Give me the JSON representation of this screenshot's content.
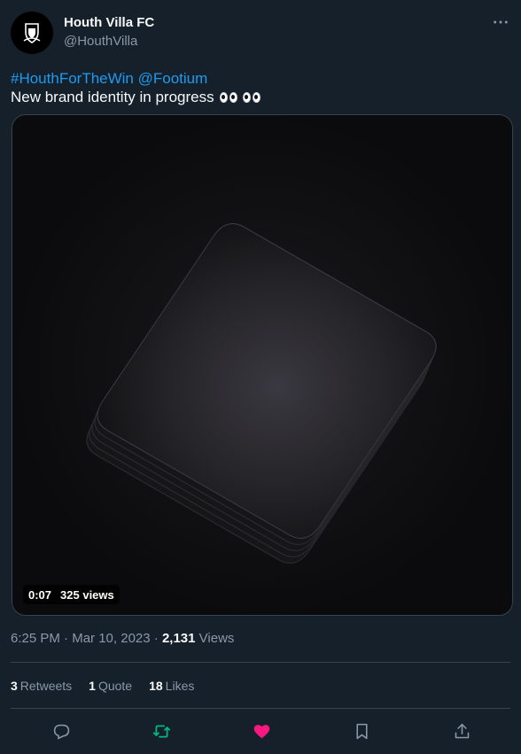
{
  "author": {
    "display_name": "Houth Villa FC",
    "handle": "@HouthVilla"
  },
  "tweet": {
    "hashtag": "#HouthForTheWin",
    "mention": "@Footium",
    "text": "New brand identity in progress"
  },
  "media": {
    "duration": "0:07",
    "views": "325 views"
  },
  "meta": {
    "time": "6:25 PM",
    "separator": "·",
    "date": "Mar 10, 2023",
    "separator2": "·",
    "view_count": "2,131",
    "views_label": "Views"
  },
  "stats": {
    "retweets_count": "3",
    "retweets_label": "Retweets",
    "quotes_count": "1",
    "quotes_label": "Quote",
    "likes_count": "18",
    "likes_label": "Likes"
  },
  "icons": {
    "reply": "reply-icon",
    "retweet": "retweet-icon",
    "like": "heart-icon",
    "bookmark": "bookmark-icon",
    "share": "share-icon",
    "more": "more-icon"
  },
  "colors": {
    "background": "#15202b",
    "link": "#1d9bf0",
    "retweet": "#00ba7c",
    "like": "#f91880",
    "muted": "#8b98a5"
  }
}
